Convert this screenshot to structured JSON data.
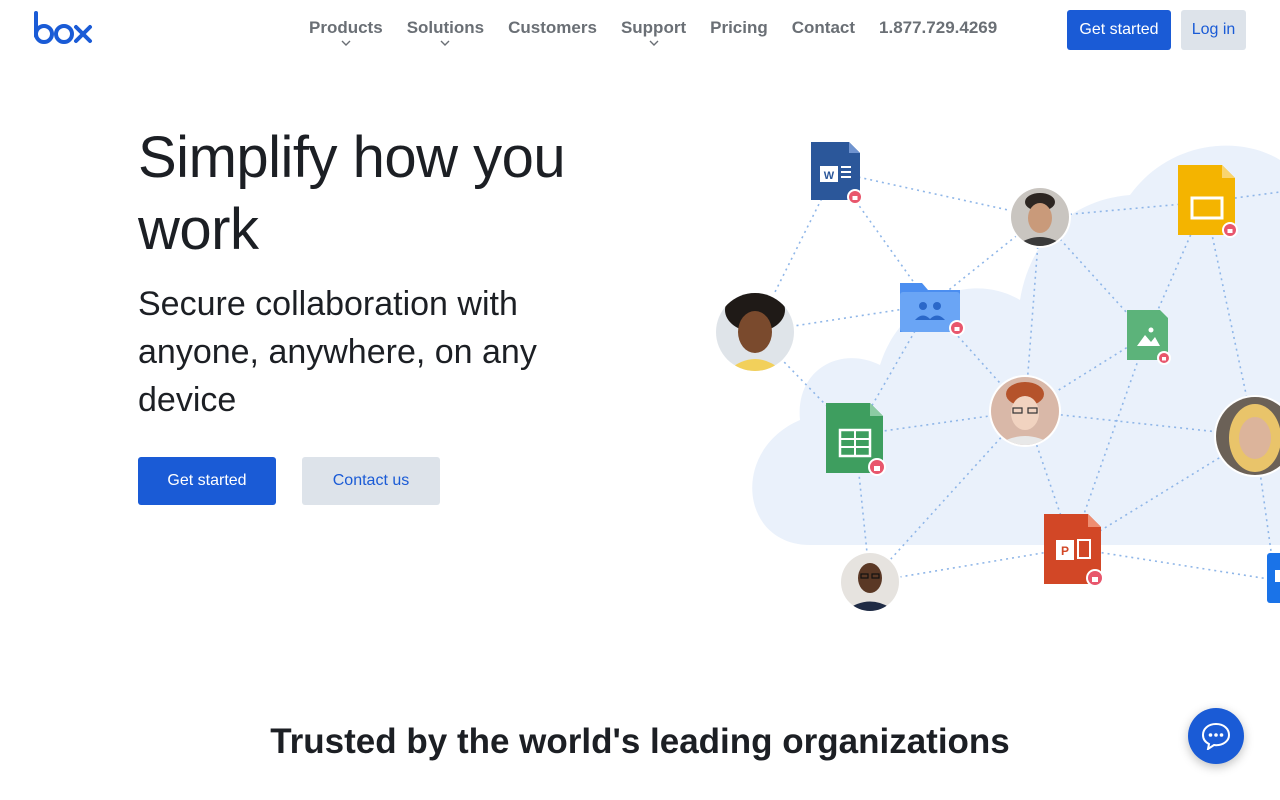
{
  "brand": {
    "logo_text": "box",
    "color": "#1a5bd6"
  },
  "nav": {
    "items": [
      {
        "label": "Products",
        "has_dropdown": true
      },
      {
        "label": "Solutions",
        "has_dropdown": true
      },
      {
        "label": "Customers",
        "has_dropdown": false
      },
      {
        "label": "Support",
        "has_dropdown": true
      },
      {
        "label": "Pricing",
        "has_dropdown": false
      },
      {
        "label": "Contact",
        "has_dropdown": false
      }
    ],
    "phone": "1.877.729.4269"
  },
  "header_actions": {
    "get_started": "Get started",
    "login": "Log in"
  },
  "hero": {
    "title": "Simplify how you work",
    "subtitle": "Secure collaboration with anyone, anywhere, on any device",
    "primary_cta": "Get started",
    "secondary_cta": "Contact us"
  },
  "illustration": {
    "icons": [
      "word-doc-icon",
      "shared-folder-icon",
      "spreadsheet-icon",
      "slides-icon",
      "image-file-icon",
      "powerpoint-icon",
      "lock-badge-icon"
    ],
    "avatars": 6
  },
  "trusted_heading": "Trusted by the world's leading organizations",
  "chat": {
    "icon": "chat-bubble-icon"
  },
  "colors": {
    "primary": "#1a5bd6",
    "secondary_bg": "#dde3ea",
    "cloud": "#eaf1fb",
    "lock_badge": "#e8566c"
  }
}
